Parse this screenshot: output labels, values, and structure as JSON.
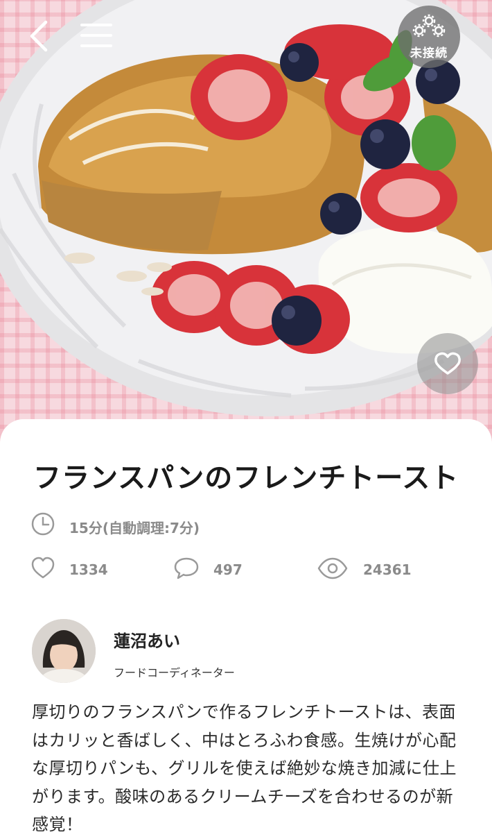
{
  "header": {
    "connection_status": "未接続",
    "back_icon": "chevron-left-icon",
    "menu_icon": "hamburger-menu-icon",
    "status_icon": "network-nodes-icon",
    "favorite_icon": "heart-outline-icon"
  },
  "recipe": {
    "title": "フランスパンのフレンチトースト",
    "time": "15分(自動調理:7分)",
    "stats": {
      "likes": "1334",
      "comments": "497",
      "views": "24361"
    }
  },
  "author": {
    "name": "蓮沼あい",
    "role": "フードコーディネーター"
  },
  "description": "厚切りのフランスパンで作るフレンチトーストは、表面はカリッと香ばしく、中はとろふわ食感。生焼けが心配な厚切りパンも、グリルを使えば絶妙な焼き加減に仕上がります。酸味のあるクリームチーズを合わせるのが新感覚！",
  "colors": {
    "accent_text": "#1a1a1a",
    "muted_text": "#8a8a8a",
    "overlay_button": "#6e6e6e"
  }
}
